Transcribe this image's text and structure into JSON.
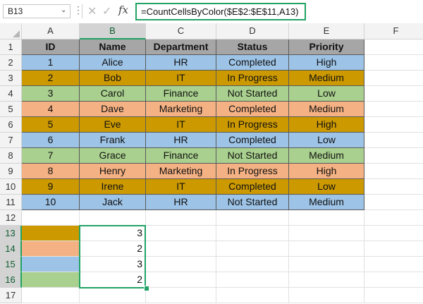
{
  "formula_bar": {
    "name_box": "B13",
    "formula": "=CountCellsByColor($E$2:$E$11,A13)",
    "fx_label": "fx"
  },
  "colors": {
    "blue": "#9dc3e6",
    "gold": "#cc9900",
    "green": "#a9d08e",
    "salmon": "#f4b183",
    "header_gray": "#a6a6a6",
    "selection": "#21a366"
  },
  "columns": [
    "A",
    "B",
    "C",
    "D",
    "E",
    "F"
  ],
  "rows": [
    "1",
    "2",
    "3",
    "4",
    "5",
    "6",
    "7",
    "8",
    "9",
    "10",
    "11",
    "12",
    "13",
    "14",
    "15",
    "16",
    "17"
  ],
  "table": {
    "headers": [
      "ID",
      "Name",
      "Department",
      "Status",
      "Priority"
    ],
    "rows": [
      {
        "color": "blue",
        "cells": [
          "1",
          "Alice",
          "HR",
          "Completed",
          "High"
        ]
      },
      {
        "color": "gold",
        "cells": [
          "2",
          "Bob",
          "IT",
          "In Progress",
          "Medium"
        ]
      },
      {
        "color": "green",
        "cells": [
          "3",
          "Carol",
          "Finance",
          "Not Started",
          "Low"
        ]
      },
      {
        "color": "salmon",
        "cells": [
          "4",
          "Dave",
          "Marketing",
          "Completed",
          "Medium"
        ]
      },
      {
        "color": "gold",
        "cells": [
          "5",
          "Eve",
          "IT",
          "In Progress",
          "High"
        ]
      },
      {
        "color": "blue",
        "cells": [
          "6",
          "Frank",
          "HR",
          "Completed",
          "Low"
        ]
      },
      {
        "color": "green",
        "cells": [
          "7",
          "Grace",
          "Finance",
          "Not Started",
          "Medium"
        ]
      },
      {
        "color": "salmon",
        "cells": [
          "8",
          "Henry",
          "Marketing",
          "In Progress",
          "High"
        ]
      },
      {
        "color": "gold",
        "cells": [
          "9",
          "Irene",
          "IT",
          "Completed",
          "Low"
        ]
      },
      {
        "color": "blue",
        "cells": [
          "10",
          "Jack",
          "HR",
          "Not Started",
          "Medium"
        ]
      }
    ]
  },
  "results": [
    {
      "color": "gold",
      "count": "3"
    },
    {
      "color": "salmon",
      "count": "2"
    },
    {
      "color": "blue",
      "count": "3"
    },
    {
      "color": "green",
      "count": "2"
    }
  ]
}
